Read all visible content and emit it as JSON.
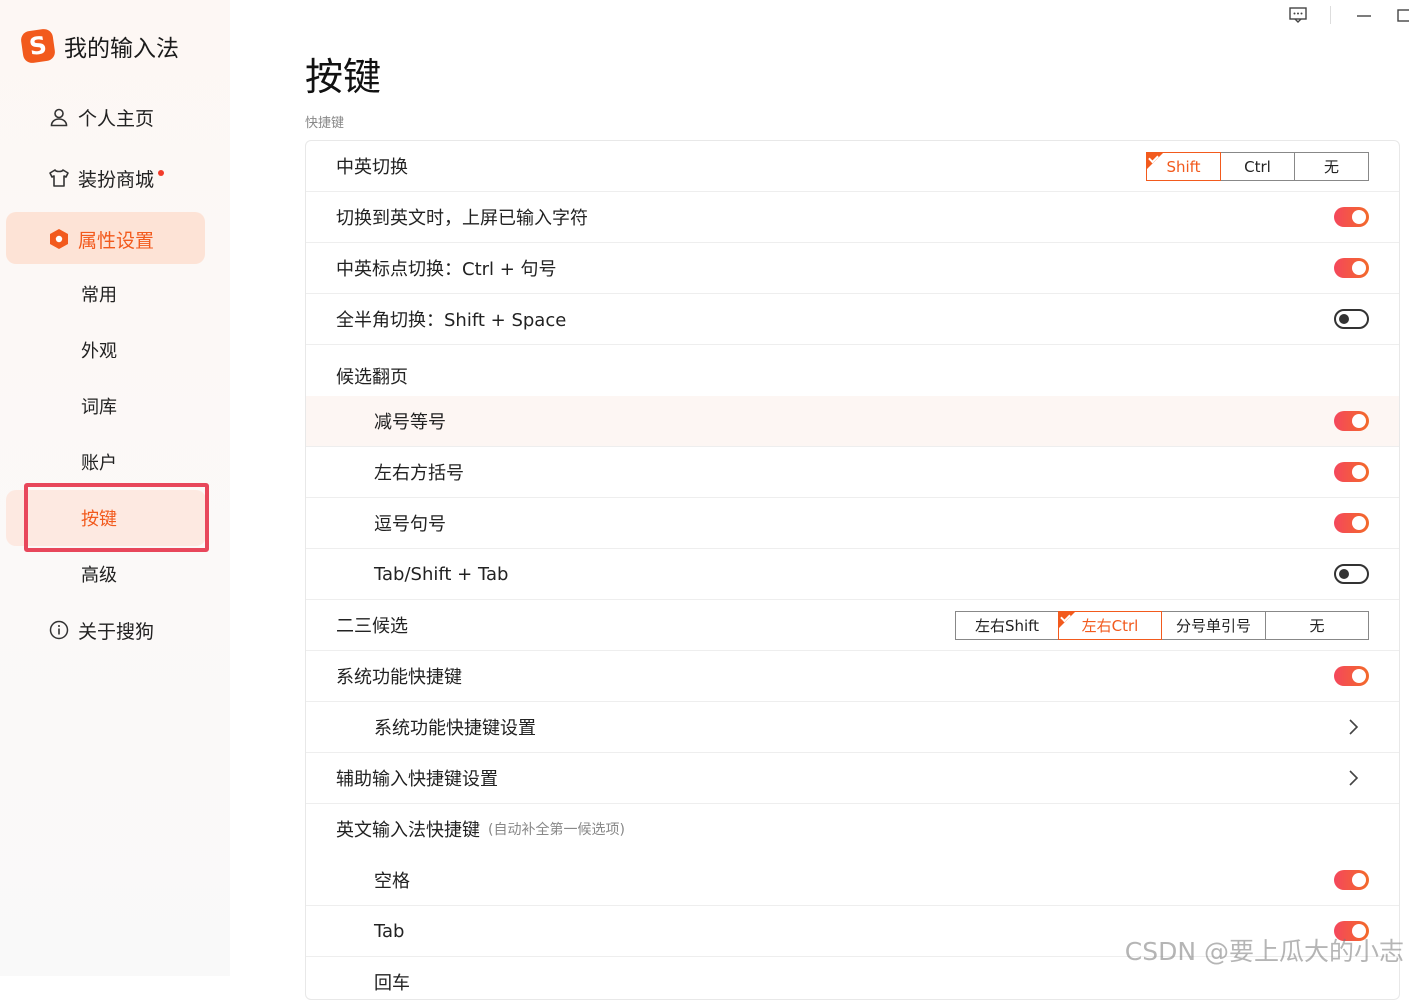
{
  "app": {
    "title": "我的输入法",
    "logo_letter": "S",
    "brand_color": "#f25a1d"
  },
  "window": {
    "feedback_icon": "chat-icon",
    "minimize_icon": "minimize-icon",
    "maximize_icon": "maximize-icon"
  },
  "sidebar": {
    "items": [
      {
        "label": "个人主页",
        "icon": "user-icon"
      },
      {
        "label": "装扮商城",
        "icon": "tshirt-icon"
      },
      {
        "label": "属性设置",
        "icon": "settings-hex-icon"
      },
      {
        "label": "关于搜狗",
        "icon": "info-icon"
      }
    ],
    "sub_items": [
      "常用",
      "外观",
      "词库",
      "账户",
      "按键",
      "高级"
    ]
  },
  "main": {
    "title": "按键",
    "section": "快捷键",
    "rows": {
      "cn_en_switch": {
        "label": "中英切换",
        "options": [
          "Shift",
          "Ctrl",
          "无"
        ],
        "selected": "Shift"
      },
      "commit_on_switch": {
        "label": "切换到英文时，上屏已输入字符",
        "on": true
      },
      "punct_switch": {
        "label": "中英标点切换：Ctrl + 句号",
        "on": true
      },
      "width_switch": {
        "label": "全半角切换：Shift + Space",
        "on": false
      },
      "paging": {
        "label": "候选翻页"
      },
      "paging_minus": {
        "label": "减号等号",
        "on": true
      },
      "paging_brackets": {
        "label": "左右方括号",
        "on": true
      },
      "paging_comma": {
        "label": "逗号句号",
        "on": true
      },
      "paging_tab": {
        "label": "Tab/Shift + Tab",
        "on": false
      },
      "second_third": {
        "label": "二三候选",
        "options": [
          "左右Shift",
          "左右Ctrl",
          "分号单引号",
          "无"
        ],
        "selected": "左右Ctrl"
      },
      "sys_shortcuts": {
        "label": "系统功能快捷键",
        "on": true
      },
      "sys_shortcut_settings": {
        "label": "系统功能快捷键设置"
      },
      "aux_shortcut_settings": {
        "label": "辅助输入快捷键设置"
      },
      "en_shortcuts": {
        "label": "英文输入法快捷键",
        "note": "(自动补全第一候选项)"
      },
      "en_space": {
        "label": "空格",
        "on": true
      },
      "en_tab": {
        "label": "Tab",
        "on": true
      },
      "en_enter": {
        "label": "回车"
      }
    }
  },
  "watermark": "CSDN @要上瓜大的小志"
}
